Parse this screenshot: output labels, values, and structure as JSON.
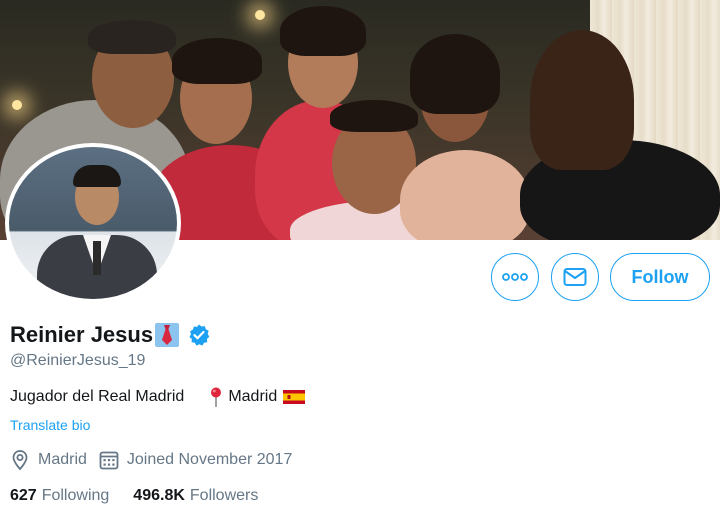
{
  "profile": {
    "name": "Reinier Jesus",
    "handle": "@ReinierJesus_19",
    "bio": "Jugador del Real Madrid",
    "bio_location": "Madrid",
    "translate_label": "Translate bio",
    "location": "Madrid",
    "joined": "Joined November 2017"
  },
  "stats": {
    "following_count": "627",
    "following_label": "Following",
    "followers_count": "496.8K",
    "followers_label": "Followers"
  },
  "actions": {
    "follow_label": "Follow"
  },
  "icons": {
    "more": "more-icon",
    "message": "envelope-icon",
    "verified": "verified-badge-icon",
    "tie_emoji": "necktie-emoji",
    "pin": "round-pushpin-emoji",
    "flag": "spain-flag-emoji",
    "location": "location-pin-icon",
    "calendar": "calendar-icon"
  },
  "colors": {
    "accent": "#1da1f2",
    "text_primary": "#14171a",
    "text_secondary": "#657786"
  }
}
